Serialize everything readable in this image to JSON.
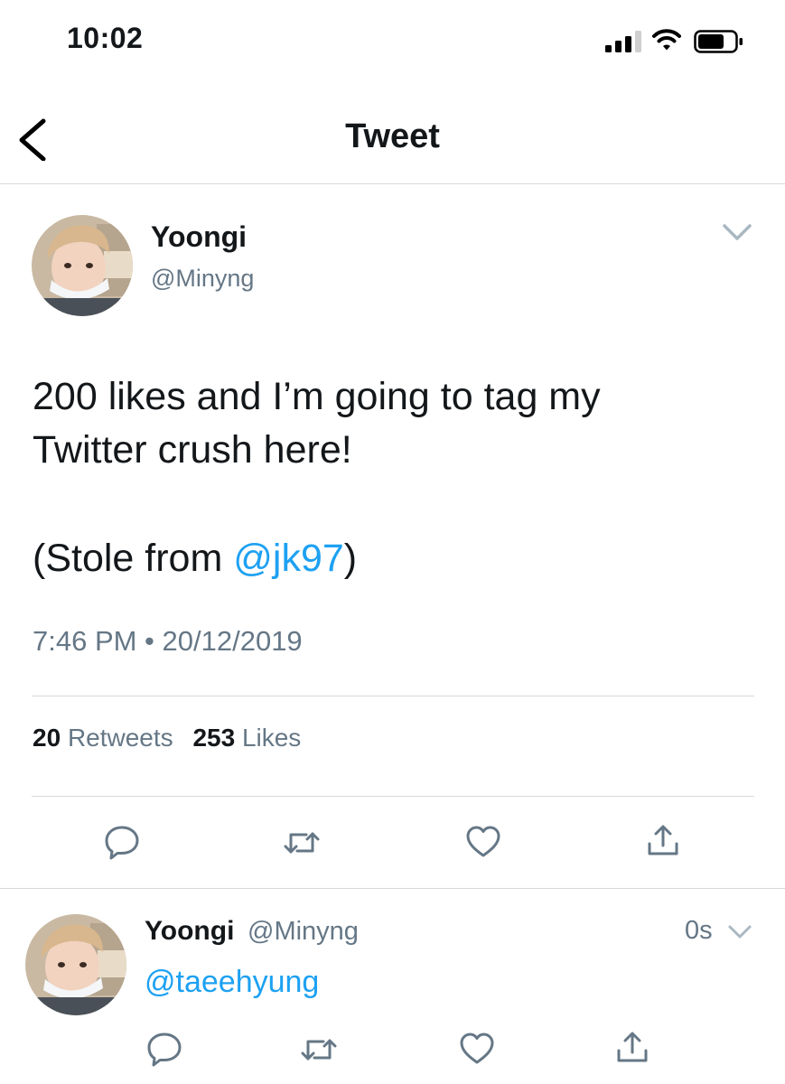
{
  "status_bar": {
    "time": "10:02",
    "icons": [
      "cellular-signal-icon",
      "wifi-icon",
      "battery-icon"
    ]
  },
  "header": {
    "title": "Tweet",
    "back_icon": "chevron-left-icon"
  },
  "tweet": {
    "author_name": "Yoongi",
    "author_handle": "@Minyng",
    "text_line1": "200 likes and I’m going to tag my",
    "text_line2": "Twitter crush here!",
    "text_line3_prefix": "(Stole from ",
    "mention": "@jk97",
    "text_line3_suffix": ")",
    "timestamp": "7:46 PM • 20/12/2019",
    "retweets_count": "20",
    "retweets_label": "Retweets",
    "likes_count": "253",
    "likes_label": "Likes",
    "actions": [
      "reply-icon",
      "retweet-icon",
      "like-icon",
      "share-icon"
    ]
  },
  "reply": {
    "author_name": "Yoongi",
    "author_handle": "@Minyng",
    "time": "0s",
    "text": "@taeehyung",
    "actions": [
      "reply-icon",
      "retweet-icon",
      "like-icon",
      "share-icon"
    ]
  },
  "colors": {
    "accent": "#1da1f2",
    "secondary_text": "#657786",
    "primary_text": "#14171a",
    "divider": "#d6d9dc"
  }
}
